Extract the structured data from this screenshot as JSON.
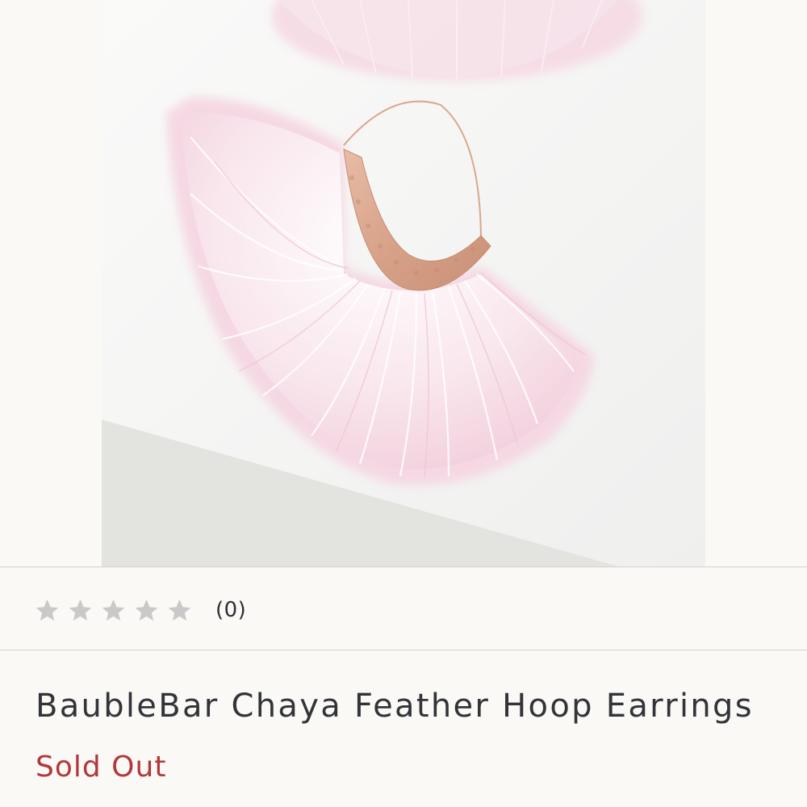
{
  "product": {
    "image_alt": "BaubleBar Chaya Feather Hoop Earrings product photo",
    "rating_stars": 0,
    "rating_max": 5,
    "review_count": "(0)",
    "title": "BaubleBar Chaya Feather Hoop Earrings",
    "status": "Sold Out"
  },
  "colors": {
    "page_background": "#faf9f5",
    "divider": "#d4d2cd",
    "star_empty": "#c9c9c9",
    "title_text": "#33343a",
    "status_text": "#b2383c",
    "feather_pink": "#f4d7e0",
    "metal_rose_gold": "#d9a78d"
  },
  "icons": {
    "star": "star-outline-icon"
  }
}
